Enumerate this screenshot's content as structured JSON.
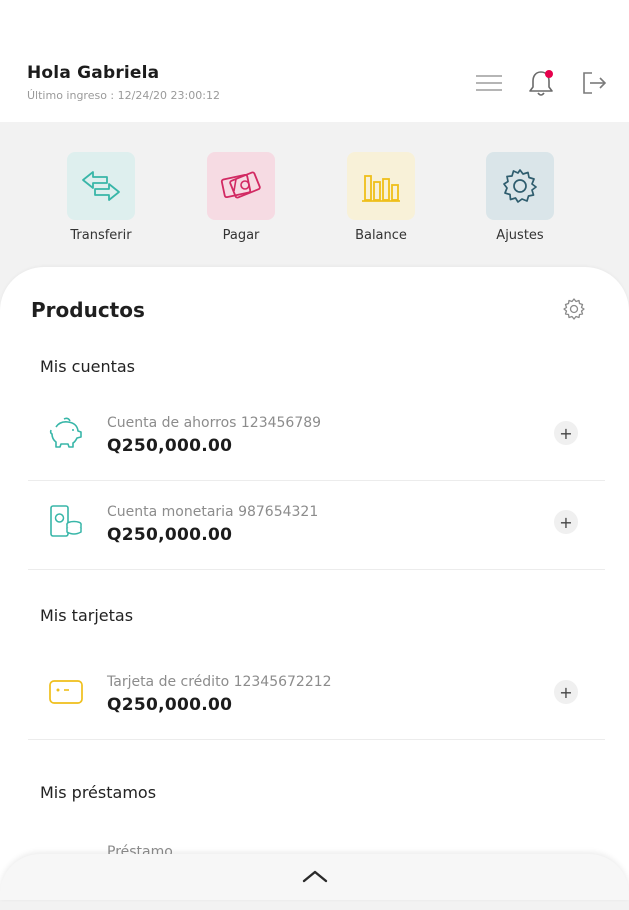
{
  "header": {
    "greeting": "Hola Gabriela",
    "last_login": "Último ingreso : 12/24/20 23:00:12",
    "notification_dot_color": "#e6004c"
  },
  "quick_actions": [
    {
      "label": "Transferir",
      "icon": "transfer-arrows-icon",
      "bg": "#deefee",
      "color": "#38b6a8"
    },
    {
      "label": "Pagar",
      "icon": "money-icon",
      "bg": "#f6dbe3",
      "color": "#d22a63"
    },
    {
      "label": "Balance",
      "icon": "bar-chart-icon",
      "bg": "#f8f1d8",
      "color": "#efbf1a"
    },
    {
      "label": "Ajustes",
      "icon": "gear-icon",
      "bg": "#dae5e9",
      "color": "#2f5d6e"
    }
  ],
  "products": {
    "title": "Productos",
    "sections": {
      "accounts": "Mis cuentas",
      "cards": "Mis tarjetas",
      "loans": "Mis préstamos"
    },
    "accounts": [
      {
        "name": "Cuenta de ahorros 123456789",
        "value": "Q250,000.00",
        "icon": "piggy-bank-icon"
      },
      {
        "name": "Cuenta monetaria 987654321",
        "value": "Q250,000.00",
        "icon": "cash-coins-icon"
      }
    ],
    "cards": [
      {
        "name": "Tarjeta de crédito 12345672212",
        "value": "Q250,000.00",
        "icon": "credit-card-icon"
      }
    ],
    "loans": [
      {
        "name": "Préstamo"
      }
    ],
    "expand_symbol": "+"
  }
}
